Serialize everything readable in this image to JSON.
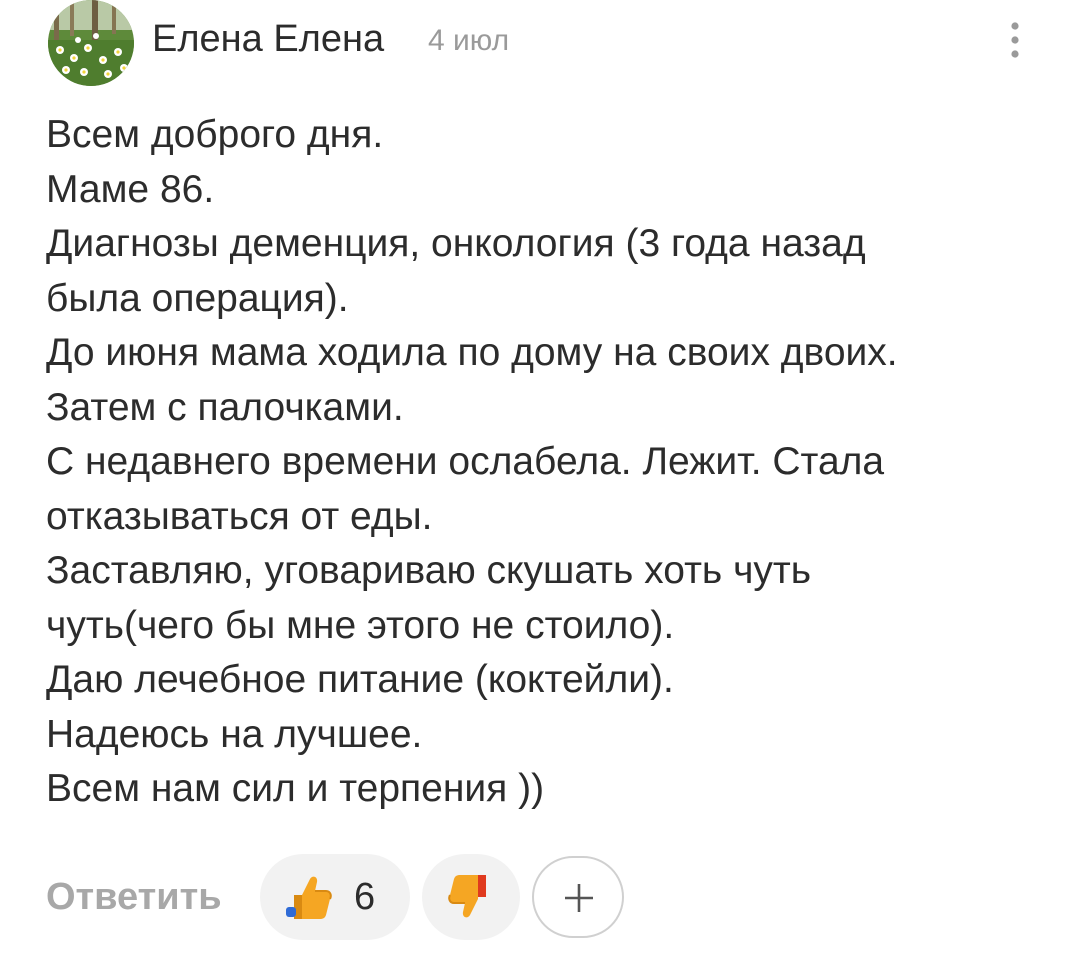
{
  "comment": {
    "author": "Елена Елена",
    "date": "4 июл",
    "lines": [
      "Всем доброго дня.",
      "Маме 86.",
      "Диагнозы деменция, онкология (3 года назад",
      "была операция).",
      "До июня мама ходила по дому на своих двоих.",
      "Затем с палочками.",
      "С недавнего времени ослабела. Лежит. Стала",
      "отказываться от еды.",
      "Заставляю, уговариваю скушать хоть чуть",
      "чуть(чего бы мне этого не стоило).",
      "Даю лечебное питание (коктейли).",
      "Надеюсь на лучшее.",
      "Всем нам сил и терпения ))"
    ]
  },
  "actions": {
    "reply_label": "Ответить",
    "like_count": "6",
    "like_icon": "thumbs-up-icon",
    "dislike_icon": "thumbs-down-icon",
    "add_icon": "plus-icon",
    "more_icon": "more-vertical-icon"
  },
  "colors": {
    "text": "#2c2c2c",
    "muted": "#9a9a9a",
    "reply": "#a8a8a8",
    "pill_bg": "#f2f2f2",
    "like_orange": "#f5a623",
    "dislike_red": "#e03a1e"
  }
}
